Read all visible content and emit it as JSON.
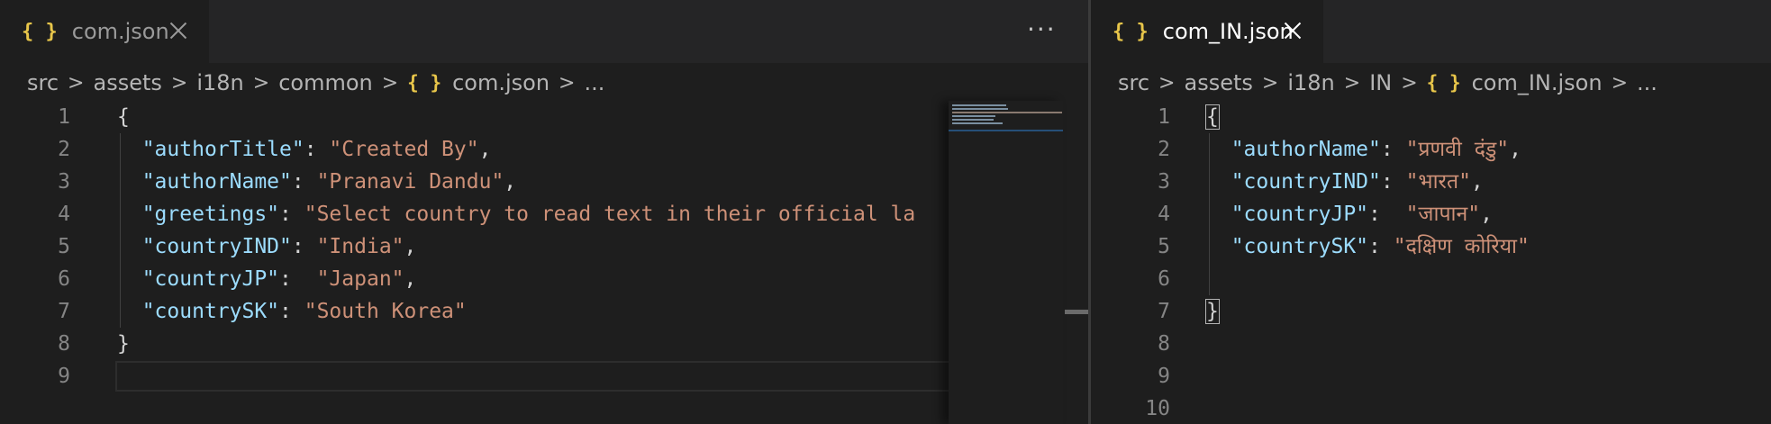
{
  "left": {
    "tab_title": "com.json",
    "tab_icon": "{ }",
    "more_actions": "···",
    "breadcrumb": [
      "src",
      "assets",
      "i18n",
      "common"
    ],
    "breadcrumb_file": "com.json",
    "breadcrumb_more": "...",
    "lines": [
      {
        "n": "1",
        "t": "{"
      },
      {
        "n": "2",
        "k": "\"authorTitle\"",
        "s": "\"Created By\"",
        "e": ","
      },
      {
        "n": "3",
        "k": "\"authorName\"",
        "s": "\"Pranavi Dandu\"",
        "e": ","
      },
      {
        "n": "4",
        "k": "\"greetings\"",
        "s": "\"Select country to read text in their official la",
        "e": ""
      },
      {
        "n": "5",
        "k": "\"countryIND\"",
        "s": "\"India\"",
        "e": ","
      },
      {
        "n": "6",
        "k": "\"countryJP\"",
        "sep": ":  ",
        "s": "\"Japan\"",
        "e": ","
      },
      {
        "n": "7",
        "k": "\"countrySK\"",
        "s": "\"South Korea\"",
        "e": ""
      },
      {
        "n": "8",
        "t": "}"
      },
      {
        "n": "9",
        "t": ""
      }
    ]
  },
  "right": {
    "tab_title": "com_IN.json",
    "tab_icon": "{ }",
    "breadcrumb": [
      "src",
      "assets",
      "i18n",
      "IN"
    ],
    "breadcrumb_file": "com_IN.json",
    "breadcrumb_more": "...",
    "lines": [
      {
        "n": "1",
        "t": "{"
      },
      {
        "n": "2",
        "k": "\"authorName\"",
        "s": "\"प्रणवी दंडु\"",
        "e": ","
      },
      {
        "n": "3",
        "k": "\"countryIND\"",
        "s": "\"भारत\"",
        "e": ","
      },
      {
        "n": "4",
        "k": "\"countryJP\"",
        "sep": ":  ",
        "s": "\"जापान\"",
        "e": ","
      },
      {
        "n": "5",
        "k": "\"countrySK\"",
        "s": "\"दक्षिण कोरिया\"",
        "e": ""
      },
      {
        "n": "6",
        "t": ""
      },
      {
        "n": "7",
        "t": "}"
      },
      {
        "n": "8",
        "t": ""
      },
      {
        "n": "9",
        "t": ""
      },
      {
        "n": "10",
        "t": ""
      }
    ]
  },
  "colors": {
    "background": "#1e1e1e",
    "key": "#9cdcfe",
    "string": "#ce9178",
    "json_icon": "#e8c64a",
    "line_number": "#858585"
  }
}
